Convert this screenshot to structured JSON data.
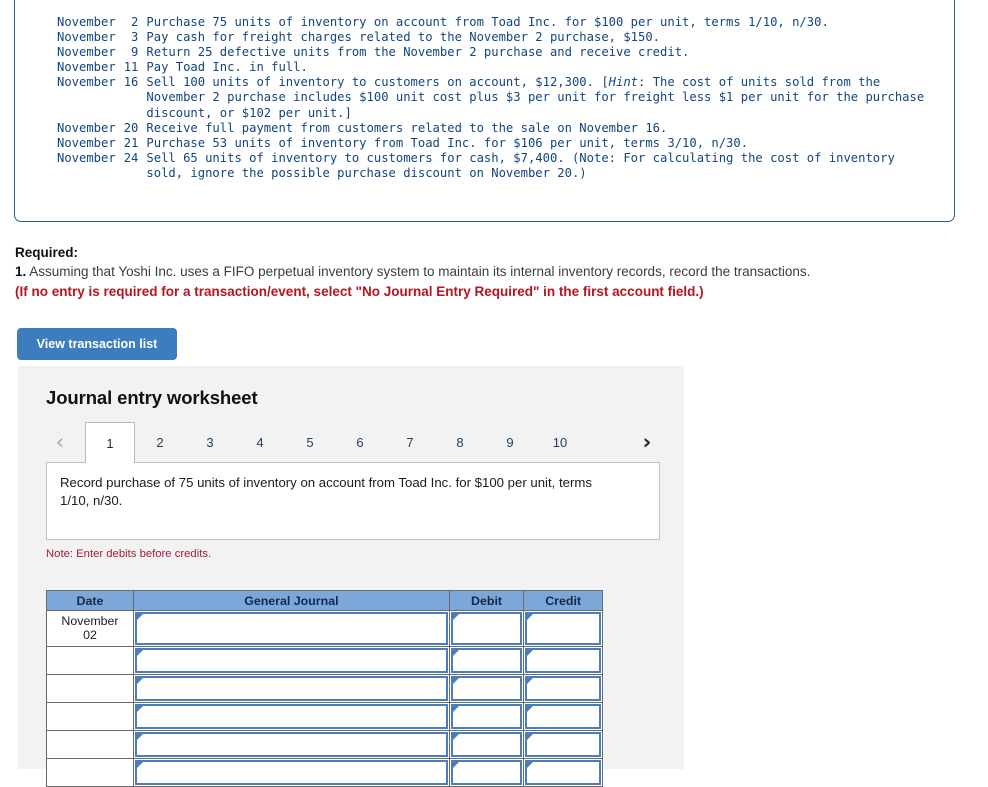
{
  "transactions": [
    {
      "month": "November",
      "day": "2",
      "lines": [
        "Purchase 75 units of inventory on account from Toad Inc. for $100 per unit, terms 1/10, n/30."
      ]
    },
    {
      "month": "November",
      "day": "3",
      "lines": [
        "Pay cash for freight charges related to the November 2 purchase, $150."
      ]
    },
    {
      "month": "November",
      "day": "9",
      "lines": [
        "Return 25 defective units from the November 2 purchase and receive credit."
      ]
    },
    {
      "month": "November",
      "day": "11",
      "lines": [
        "Pay Toad Inc. in full."
      ]
    },
    {
      "month": "November",
      "day": "16",
      "lines": [
        "Sell 100 units of inventory to customers on account, $12,300. [",
        "November 2 purchase includes $100 unit cost plus $3 per unit for freight less $1 per unit for the purchase",
        "discount, or $102 per unit.]"
      ],
      "hint_label": "Hint",
      "hint_tail": ": The cost of units sold from the"
    },
    {
      "month": "November",
      "day": "20",
      "lines": [
        "Receive full payment from customers related to the sale on November 16."
      ]
    },
    {
      "month": "November",
      "day": "21",
      "lines": [
        "Purchase 53 units of inventory from Toad Inc. for $106 per unit, terms 3/10, n/30."
      ]
    },
    {
      "month": "November",
      "day": "24",
      "lines": [
        "Sell 65 units of inventory to customers for cash, $7,400. (Note: For calculating the cost of inventory",
        "sold, ignore the possible purchase discount on November 20.)"
      ]
    }
  ],
  "required": {
    "title": "Required:",
    "item_number": "1.",
    "item_text": " Assuming that Yoshi Inc. uses a FIFO perpetual inventory system to maintain its internal inventory records, record the transactions.",
    "red_note": "(If no entry is required for a transaction/event, select \"No Journal Entry Required\" in the first account field.)"
  },
  "view_button": {
    "label": "View transaction list"
  },
  "worksheet": {
    "title": "Journal entry worksheet",
    "prev_arrow": "‹",
    "next_arrow": "›",
    "tabs": [
      "1",
      "2",
      "3",
      "4",
      "5",
      "6",
      "7",
      "8",
      "9",
      "10"
    ],
    "active_tab": "1",
    "description": "Record purchase of 75 units of inventory on account from Toad Inc. for $100 per unit, terms 1/10, n/30.",
    "note": "Note: Enter debits before credits.",
    "table": {
      "headers": [
        "Date",
        "General Journal",
        "Debit",
        "Credit"
      ],
      "rows": [
        {
          "date_line1": "November",
          "date_line2": "02",
          "general_journal": "",
          "debit": "",
          "credit": ""
        },
        {
          "date_line1": "",
          "date_line2": "",
          "general_journal": "",
          "debit": "",
          "credit": ""
        },
        {
          "date_line1": "",
          "date_line2": "",
          "general_journal": "",
          "debit": "",
          "credit": ""
        },
        {
          "date_line1": "",
          "date_line2": "",
          "general_journal": "",
          "debit": "",
          "credit": ""
        },
        {
          "date_line1": "",
          "date_line2": "",
          "general_journal": "",
          "debit": "",
          "credit": ""
        },
        {
          "date_line1": "",
          "date_line2": "",
          "general_journal": "",
          "debit": "",
          "credit": ""
        }
      ]
    }
  },
  "colors": {
    "transaction_text": "#13457e",
    "accent_blue": "#3b7dbf",
    "header_blue": "#7da7d9",
    "red_note": "#b4151e",
    "note_maroon": "#9e2037"
  }
}
